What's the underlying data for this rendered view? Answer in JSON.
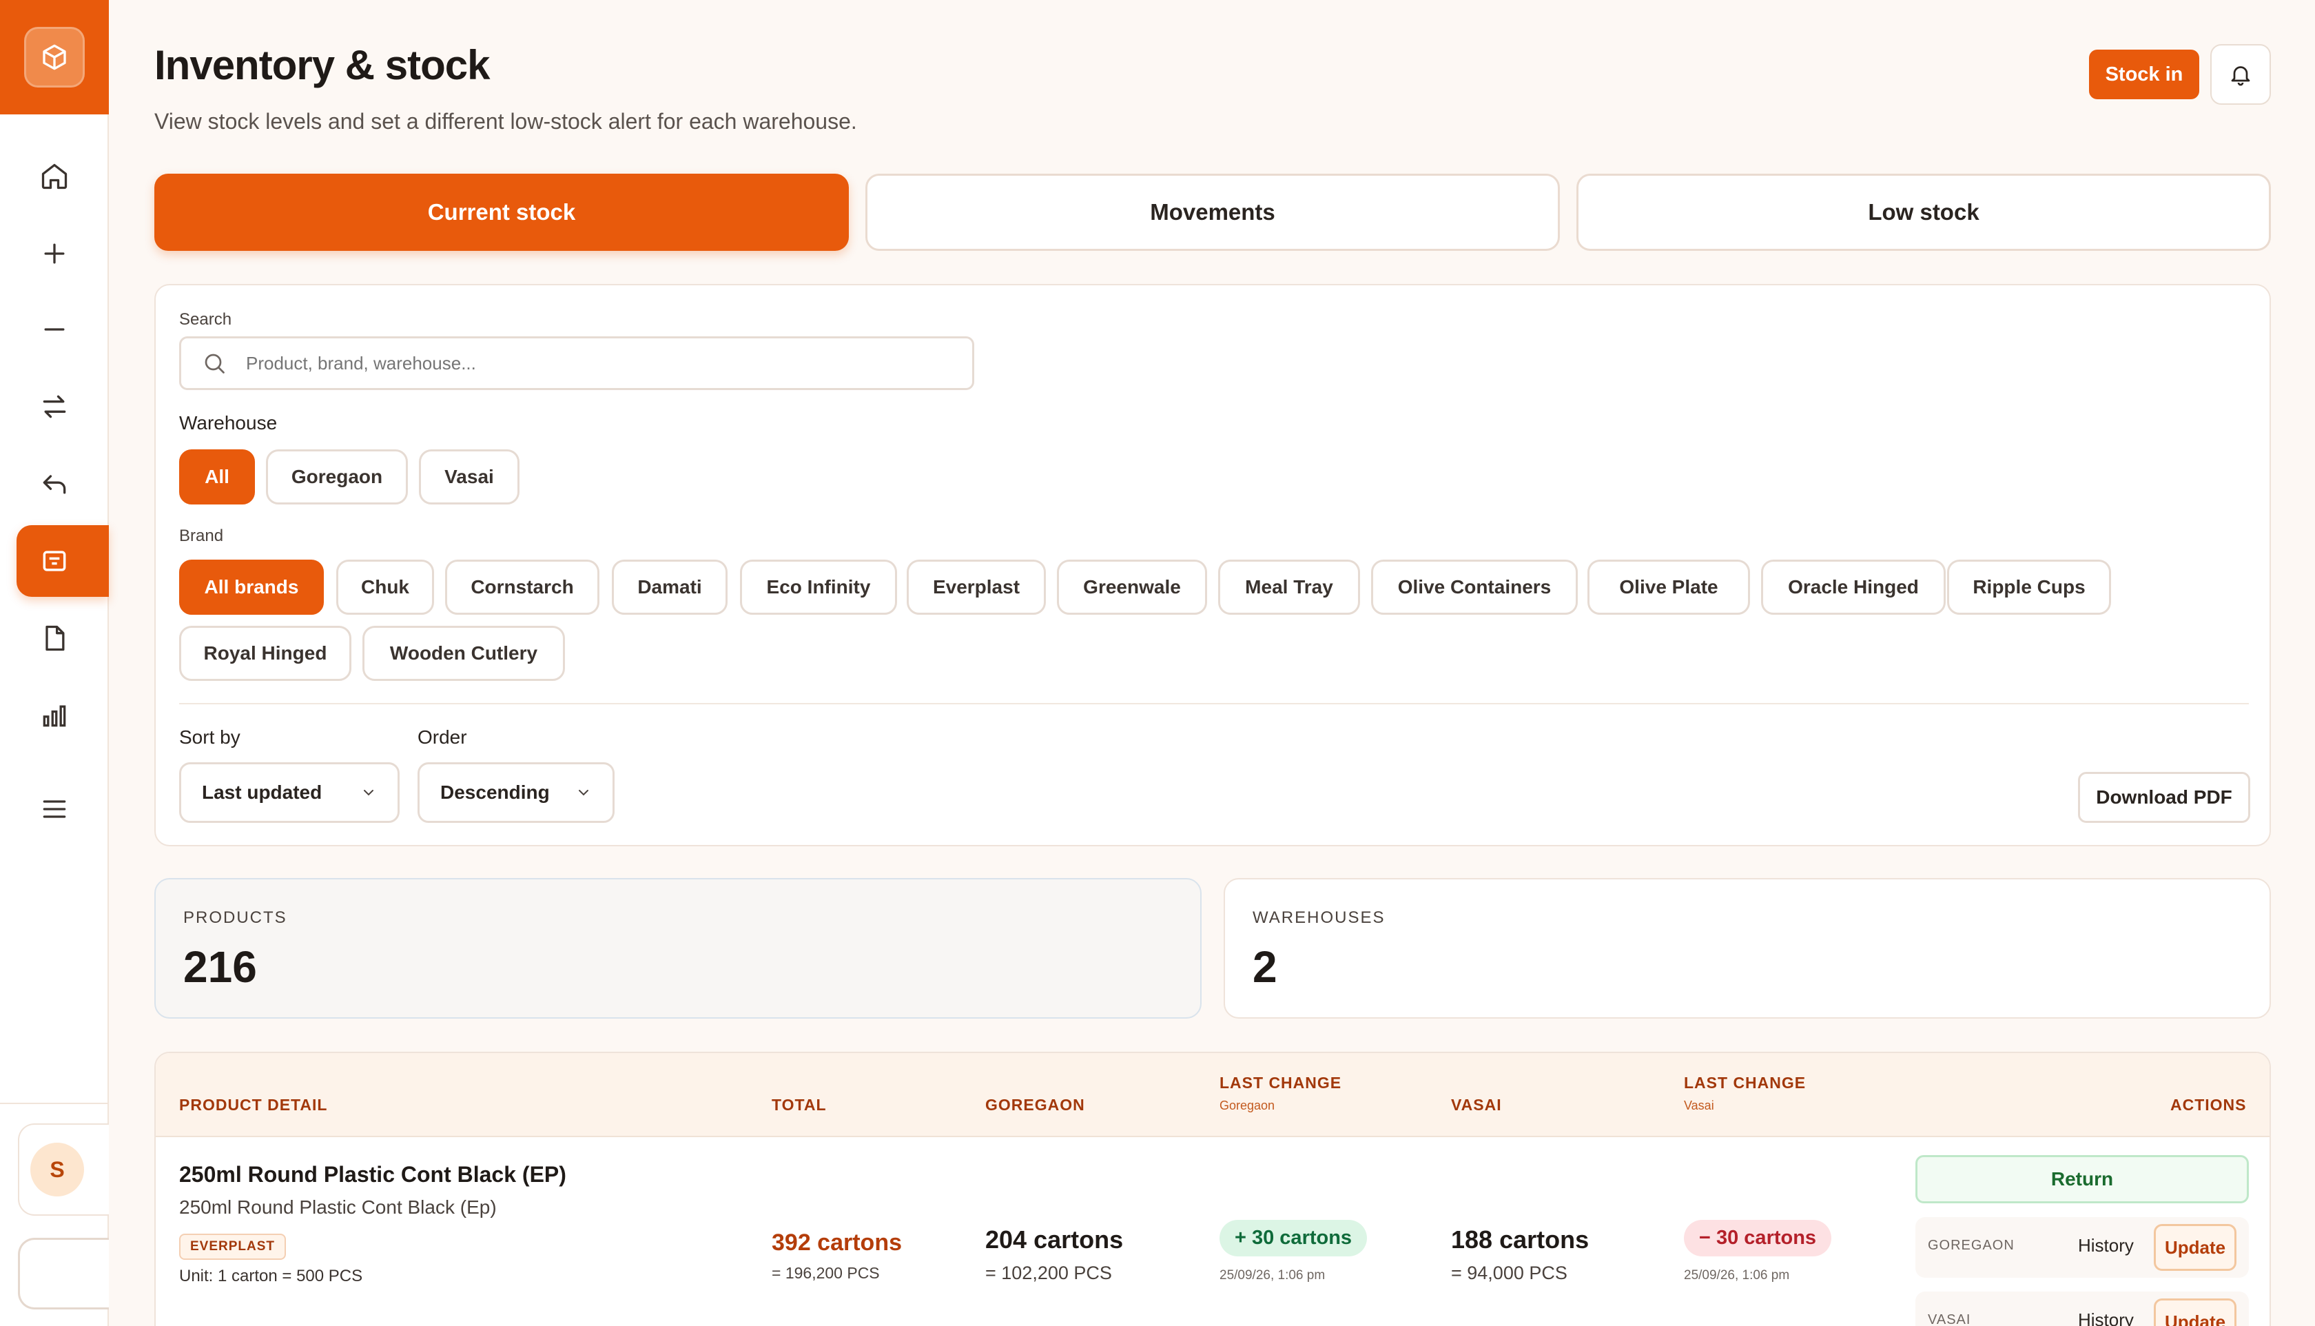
{
  "header": {
    "title": "Inventory & stock",
    "subtitle": "View stock levels and set a different low-stock alert for each warehouse.",
    "stock_in_label": "Stock in"
  },
  "sidebar": {
    "icons": [
      "box-icon",
      "home-icon",
      "plus-icon",
      "minus-icon",
      "swap-icon",
      "return-icon",
      "inventory-icon",
      "document-icon",
      "chart-icon",
      "menu-icon"
    ],
    "active_item": "inventory-icon",
    "user_initial": "S"
  },
  "tabs": [
    {
      "label": "Current stock",
      "active": true
    },
    {
      "label": "Movements",
      "active": false
    },
    {
      "label": "Low stock",
      "active": false
    }
  ],
  "filters": {
    "search_label": "Search",
    "search_placeholder": "Product, brand, warehouse...",
    "warehouse_label": "Warehouse",
    "warehouses": [
      {
        "label": "All",
        "active": true
      },
      {
        "label": "Goregaon",
        "active": false
      },
      {
        "label": "Vasai",
        "active": false
      }
    ],
    "brand_label": "Brand",
    "brands": [
      {
        "label": "All brands",
        "active": true
      },
      {
        "label": "Chuk",
        "active": false
      },
      {
        "label": "Cornstarch",
        "active": false
      },
      {
        "label": "Damati",
        "active": false
      },
      {
        "label": "Eco Infinity",
        "active": false
      },
      {
        "label": "Everplast",
        "active": false
      },
      {
        "label": "Greenwale",
        "active": false
      },
      {
        "label": "Meal Tray",
        "active": false
      },
      {
        "label": "Olive Containers",
        "active": false
      },
      {
        "label": "Olive Plate",
        "active": false
      },
      {
        "label": "Oracle Hinged",
        "active": false
      },
      {
        "label": "Ripple Cups",
        "active": false
      },
      {
        "label": "Royal Hinged",
        "active": false
      },
      {
        "label": "Wooden Cutlery",
        "active": false
      }
    ],
    "sort_label": "Sort by",
    "sort_value": "Last updated",
    "order_label": "Order",
    "order_value": "Descending",
    "download_label": "Download PDF"
  },
  "stats": [
    {
      "label": "PRODUCTS",
      "value": "216"
    },
    {
      "label": "WAREHOUSES",
      "value": "2"
    }
  ],
  "table": {
    "columns": {
      "product": "PRODUCT DETAIL",
      "total": "TOTAL",
      "goregaon": "GOREGAON",
      "last_change_1": "LAST CHANGE",
      "last_change_1_sub": "Goregaon",
      "vasai": "VASAI",
      "last_change_2": "LAST CHANGE",
      "last_change_2_sub": "Vasai",
      "actions": "ACTIONS"
    },
    "rows": [
      {
        "name": "250ml Round Plastic Cont Black (EP)",
        "subname": "250ml Round Plastic Cont Black (Ep)",
        "brand": "EVERPLAST",
        "unit": "Unit: 1 carton = 500 PCS",
        "total": "392 cartons",
        "total_pcs": "= 196,200 PCS",
        "goregaon": "204 cartons",
        "goregaon_pcs": "= 102,200 PCS",
        "goregaon_change": "+ 30 cartons",
        "goregaon_change_time": "25/09/26, 1:06 pm",
        "vasai": "188 cartons",
        "vasai_pcs": "= 94,000 PCS",
        "vasai_change": "− 30 cartons",
        "vasai_change_time": "25/09/26, 1:06 pm",
        "return_label": "Return",
        "actions": [
          {
            "warehouse": "GOREGAON",
            "history": "History",
            "update": "Update"
          },
          {
            "warehouse": "VASAI",
            "history": "History",
            "update": "Update"
          }
        ]
      }
    ]
  },
  "colors": {
    "accent": "#e85a0c",
    "positive": "#0f6b3a",
    "negative": "#b4202a"
  }
}
